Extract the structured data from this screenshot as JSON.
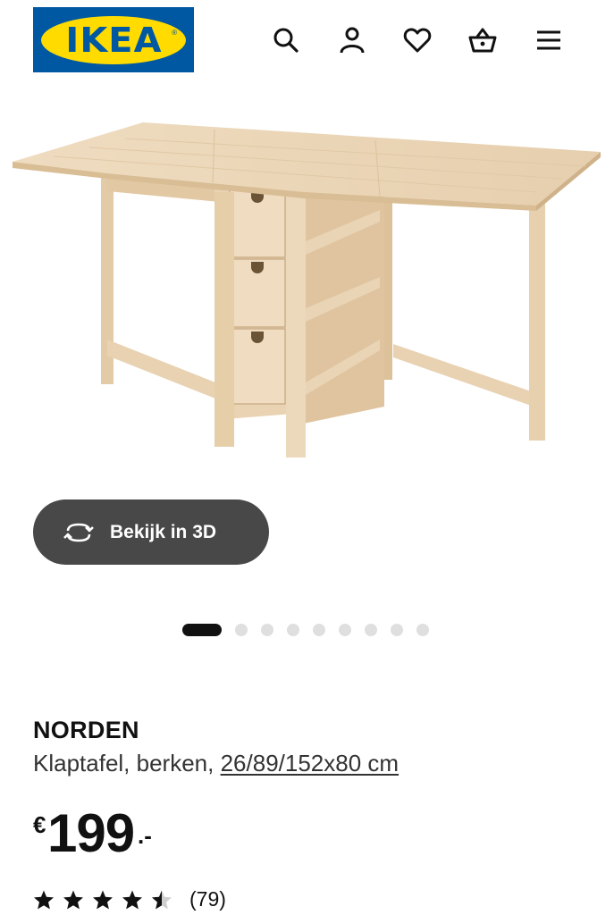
{
  "header": {
    "logo_text": "IKEA",
    "logo_mark": "®",
    "brand_colors": {
      "blue": "#0058a3",
      "yellow": "#ffdb00"
    },
    "icons": [
      "search-icon",
      "user-icon",
      "heart-icon",
      "basket-icon",
      "menu-icon"
    ]
  },
  "gallery": {
    "view_3d_label": "Bekijk in 3D",
    "total_images": 9,
    "active_index": 0
  },
  "product": {
    "name": "NORDEN",
    "description": "Klaptafel, berken,",
    "dimensions": "26/89/152x80 cm",
    "price": {
      "currency": "€",
      "amount": "199",
      "suffix": ".-"
    },
    "rating": {
      "value": 4.5,
      "max": 5,
      "count_label": "(79)"
    }
  }
}
